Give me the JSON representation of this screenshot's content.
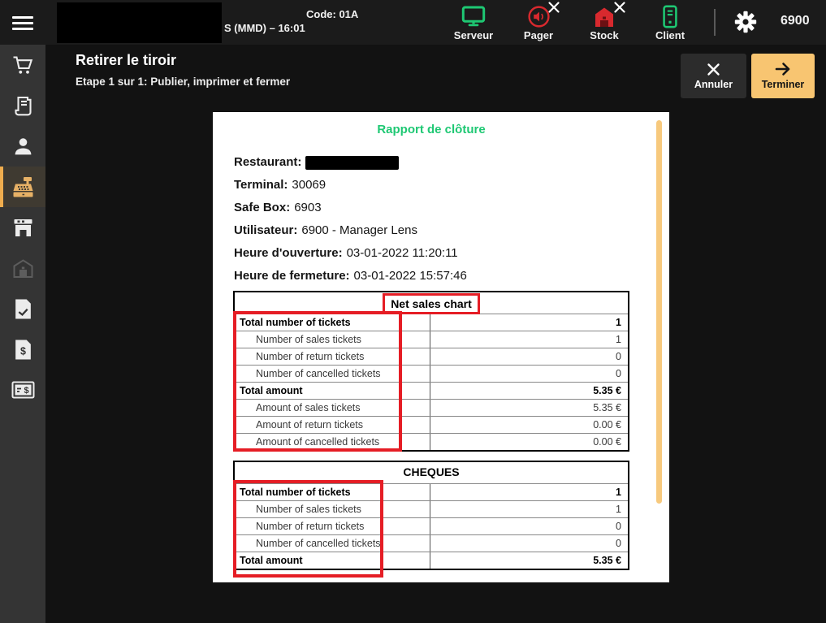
{
  "topbar": {
    "code_label": "Code: 01A",
    "session_label": "S (MMD) – 16:01",
    "user_code": "6900",
    "status_icons": [
      {
        "label": "Serveur",
        "icon": "monitor-icon",
        "state": "ok",
        "color": "#1ec873"
      },
      {
        "label": "Pager",
        "icon": "speaker-icon",
        "state": "error",
        "color": "#d8292e"
      },
      {
        "label": "Stock",
        "icon": "warehouse-icon",
        "state": "error",
        "color": "#d8292e"
      },
      {
        "label": "Client",
        "icon": "tower-icon",
        "state": "ok",
        "color": "#1ec873"
      }
    ]
  },
  "header": {
    "title": "Retirer le tiroir",
    "subtitle": "Etape 1 sur 1: Publier, imprimer et fermer",
    "cancel_label": "Annuler",
    "finish_label": "Terminer"
  },
  "sidebar": {
    "items": [
      {
        "icon": "cart-icon",
        "active": false
      },
      {
        "icon": "receipt-icon",
        "active": false
      },
      {
        "icon": "person-icon",
        "active": false
      },
      {
        "icon": "cash-register-icon",
        "active": true
      },
      {
        "icon": "store-icon",
        "active": false
      },
      {
        "icon": "warehouse-icon",
        "active": false,
        "disabled": true
      },
      {
        "icon": "document-chart-icon",
        "active": false
      },
      {
        "icon": "document-dollar-icon",
        "active": false
      },
      {
        "icon": "cheque-icon",
        "active": false
      }
    ]
  },
  "report": {
    "title": "Rapport de clôture",
    "info": [
      {
        "label": "Restaurant:",
        "value": "",
        "redacted": true
      },
      {
        "label": "Terminal:",
        "value": "30069"
      },
      {
        "label": "Safe Box:",
        "value": "6903"
      },
      {
        "label": "Utilisateur:",
        "value": "6900 - Manager Lens"
      },
      {
        "label": "Heure d'ouverture:",
        "value": "03-01-2022 11:20:11"
      },
      {
        "label": "Heure de fermeture:",
        "value": "03-01-2022 15:57:46"
      }
    ],
    "tables": [
      {
        "title": "Net sales chart",
        "title_highlighted": true,
        "rows": [
          {
            "label": "Total number of tickets",
            "value": "1",
            "bold": true
          },
          {
            "label": "Number of sales tickets",
            "value": "1"
          },
          {
            "label": "Number of return tickets",
            "value": "0"
          },
          {
            "label": "Number of cancelled tickets",
            "value": "0"
          },
          {
            "label": "Total amount",
            "value": "5.35 €",
            "bold": true
          },
          {
            "label": "Amount of sales tickets",
            "value": "5.35 €"
          },
          {
            "label": "Amount of return tickets",
            "value": "0.00 €"
          },
          {
            "label": "Amount of cancelled tickets",
            "value": "0.00 €"
          }
        ]
      },
      {
        "title": "CHEQUES",
        "title_highlighted": false,
        "rows": [
          {
            "label": "Total number of tickets",
            "value": "1",
            "bold": true
          },
          {
            "label": "Number of sales tickets",
            "value": "1"
          },
          {
            "label": "Number of return tickets",
            "value": "0"
          },
          {
            "label": "Number of cancelled tickets",
            "value": "0"
          },
          {
            "label": "Total amount",
            "value": "5.35 €",
            "bold": true
          }
        ]
      }
    ]
  },
  "colors": {
    "accent_orange": "#f8c571",
    "sidebar_active_orange": "#f0ad4e",
    "status_green": "#1ec873",
    "status_red": "#d8292e",
    "annotation_red": "#e51d25",
    "report_title_green": "#1ec873"
  }
}
